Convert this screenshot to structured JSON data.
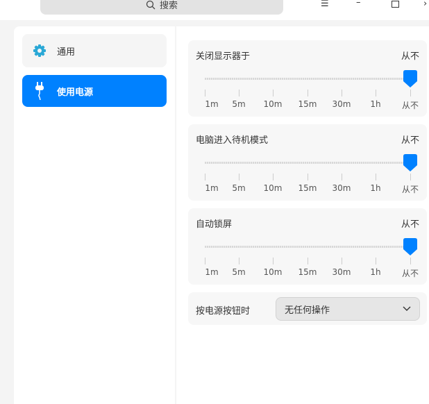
{
  "titlebar": {
    "search_placeholder": "搜索"
  },
  "sidebar": {
    "items": [
      {
        "label": "通用",
        "icon": "gear-icon"
      },
      {
        "label": "使用电源",
        "icon": "plug-icon",
        "active": true
      }
    ]
  },
  "accent": "#0081ff",
  "settings": [
    {
      "title": "关闭显示器于",
      "value": "从不",
      "ticks": [
        "1m",
        "5m",
        "10m",
        "15m",
        "30m",
        "1h",
        "从不"
      ],
      "selected_index": 6
    },
    {
      "title": "电脑进入待机模式",
      "value": "从不",
      "ticks": [
        "1m",
        "5m",
        "10m",
        "15m",
        "30m",
        "1h",
        "从不"
      ],
      "selected_index": 6
    },
    {
      "title": "自动锁屏",
      "value": "从不",
      "ticks": [
        "1m",
        "5m",
        "10m",
        "15m",
        "30m",
        "1h",
        "从不"
      ],
      "selected_index": 6
    }
  ],
  "power_button": {
    "label": "按电源按钮时",
    "selected": "无任何操作"
  }
}
